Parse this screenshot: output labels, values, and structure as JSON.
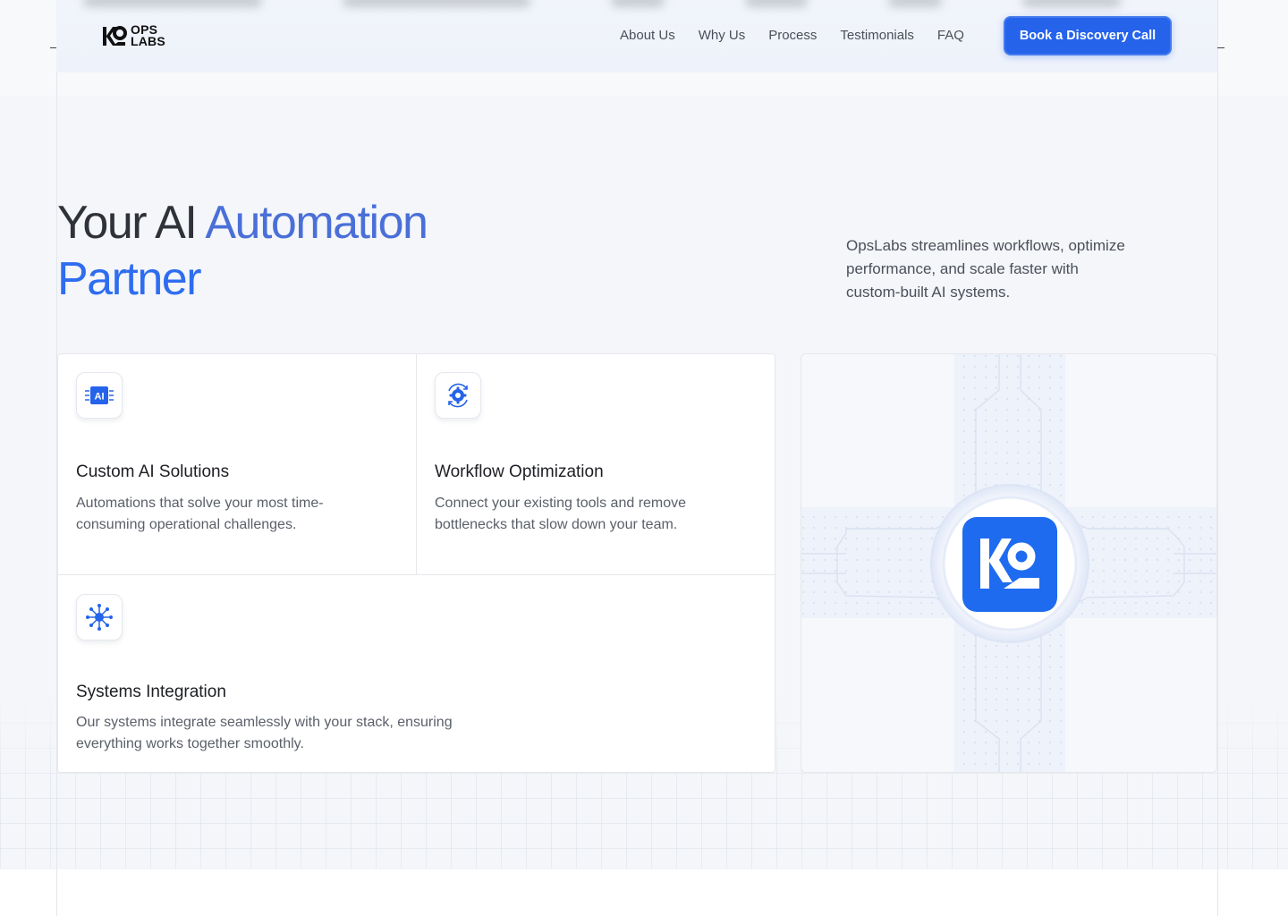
{
  "brand": {
    "logo_line1": "OPS",
    "logo_line2": "LABS",
    "accent": "#2563eb"
  },
  "nav": {
    "items": [
      "About Us",
      "Why Us",
      "Process",
      "Testimonials",
      "FAQ"
    ],
    "cta_label": "Book a Discovery Call"
  },
  "hero": {
    "title_part1": "Your AI ",
    "title_part2": "Automation",
    "title_part3": "Partner",
    "description": "OpsLabs streamlines workflows, optimize performance, and scale faster with custom-built AI systems."
  },
  "features": [
    {
      "icon": "ai-chip-icon",
      "title": "Custom AI Solutions",
      "description": "Automations that solve your most time-consuming operational challenges."
    },
    {
      "icon": "gear-sync-icon",
      "title": "Workflow Optimization",
      "description": "Connect your existing tools and remove bottlenecks that slow down your team."
    },
    {
      "icon": "network-hub-icon",
      "title": "Systems Integration",
      "description": "Our systems integrate seamlessly with your stack, ensuring everything works together smoothly."
    }
  ],
  "icon_labels": {
    "ai_chip": "AI"
  }
}
